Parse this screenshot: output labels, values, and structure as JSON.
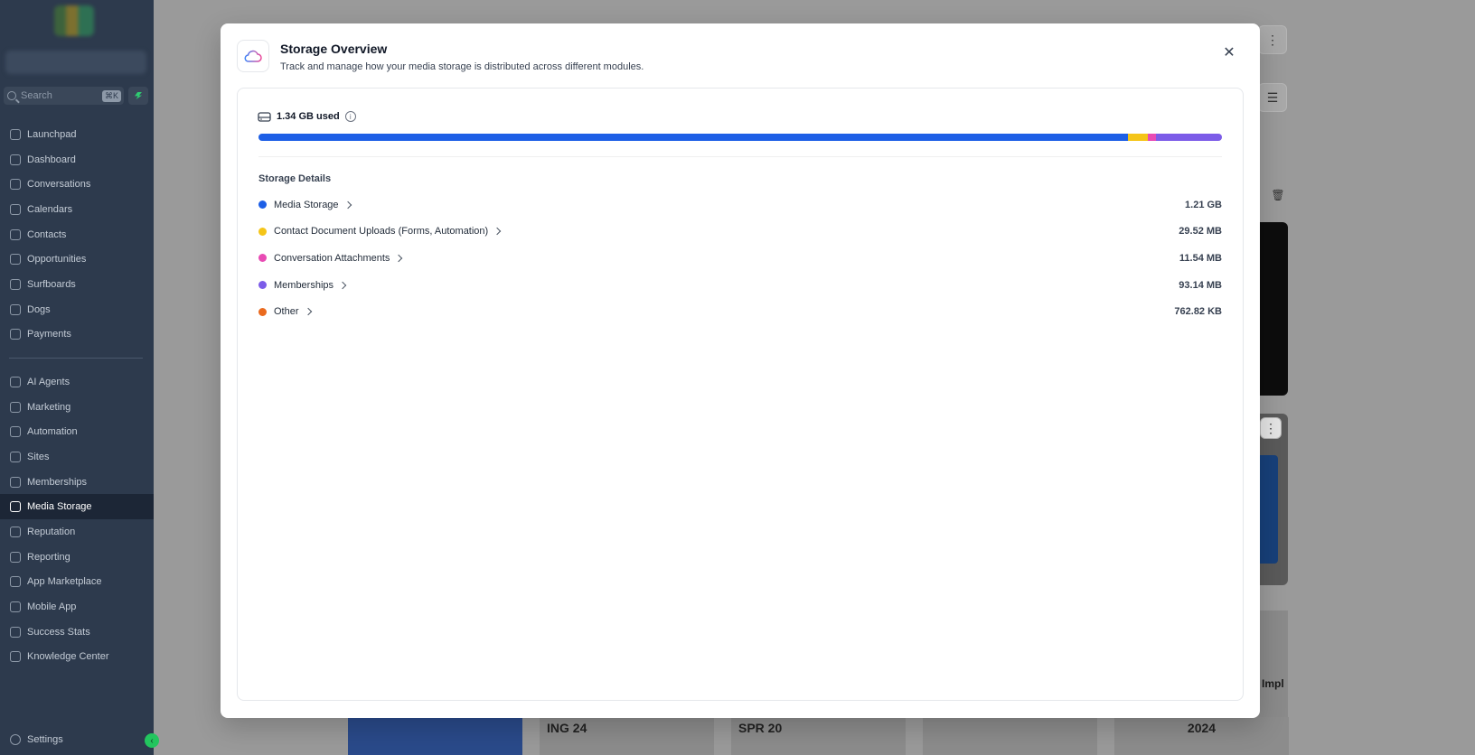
{
  "sidebar": {
    "search_placeholder": "Search",
    "search_shortcut": "⌘K",
    "items_top": [
      {
        "label": "Launchpad"
      },
      {
        "label": "Dashboard"
      },
      {
        "label": "Conversations"
      },
      {
        "label": "Calendars"
      },
      {
        "label": "Contacts"
      },
      {
        "label": "Opportunities"
      },
      {
        "label": "Surfboards"
      },
      {
        "label": "Dogs"
      },
      {
        "label": "Payments"
      }
    ],
    "items_bottom": [
      {
        "label": "AI Agents"
      },
      {
        "label": "Marketing"
      },
      {
        "label": "Automation"
      },
      {
        "label": "Sites"
      },
      {
        "label": "Memberships"
      },
      {
        "label": "Media Storage"
      },
      {
        "label": "Reputation"
      },
      {
        "label": "Reporting"
      },
      {
        "label": "App Marketplace"
      },
      {
        "label": "Mobile App"
      },
      {
        "label": "Success Stats"
      },
      {
        "label": "Knowledge Center"
      }
    ],
    "active_item": "Media Storage",
    "settings_label": "Settings"
  },
  "background": {
    "thumb_texts": [
      "",
      "ING 24",
      "SPR 20",
      "",
      "2024"
    ],
    "card_text": "Impl"
  },
  "modal": {
    "title": "Storage Overview",
    "subtitle": "Track and manage how your media storage is distributed across different modules.",
    "used_label": "1.34 GB used",
    "details_title": "Storage Details",
    "usage_fractions": [
      0.9025,
      0.0208,
      0.0081,
      0.0686
    ],
    "categories": [
      {
        "label": "Media Storage",
        "value": "1.21 GB",
        "color": "#1d5fe6"
      },
      {
        "label": "Contact Document Uploads (Forms, Automation)",
        "value": "29.52 MB",
        "color": "#f5c518"
      },
      {
        "label": "Conversation Attachments",
        "value": "11.54 MB",
        "color": "#e84bb4"
      },
      {
        "label": "Memberships",
        "value": "93.14 MB",
        "color": "#7c5ce8"
      },
      {
        "label": "Other",
        "value": "762.82 KB",
        "color": "#ea6a1e"
      }
    ]
  }
}
